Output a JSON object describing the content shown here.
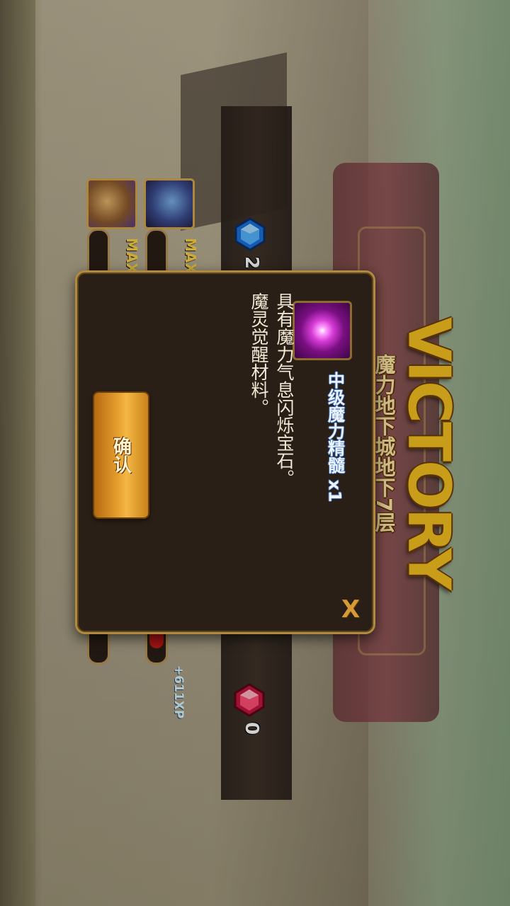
{
  "header": {
    "victory_text": "VICTORY",
    "dungeon_floor": "魔力地下城地下7层"
  },
  "rewards": {
    "blue_gem_count": "2",
    "red_gem_count": "0"
  },
  "monsters": [
    {
      "status": "MAX"
    },
    {
      "status": "MAX"
    }
  ],
  "xp_gain": "+611XP",
  "dialog": {
    "item_name": "中级魔力精髓 x1",
    "description_line1": "具有魔力气息闪烁宝石。",
    "description_line2": "魔灵觉醒材料。",
    "confirm_label": "确认",
    "close_label": "X"
  },
  "colors": {
    "victory": "#f4c020",
    "dialog_bg": "#2a1f16",
    "dialog_border": "#b18a3e",
    "confirm_button": "#e7a02e",
    "item_icon": "#d53bd5"
  }
}
